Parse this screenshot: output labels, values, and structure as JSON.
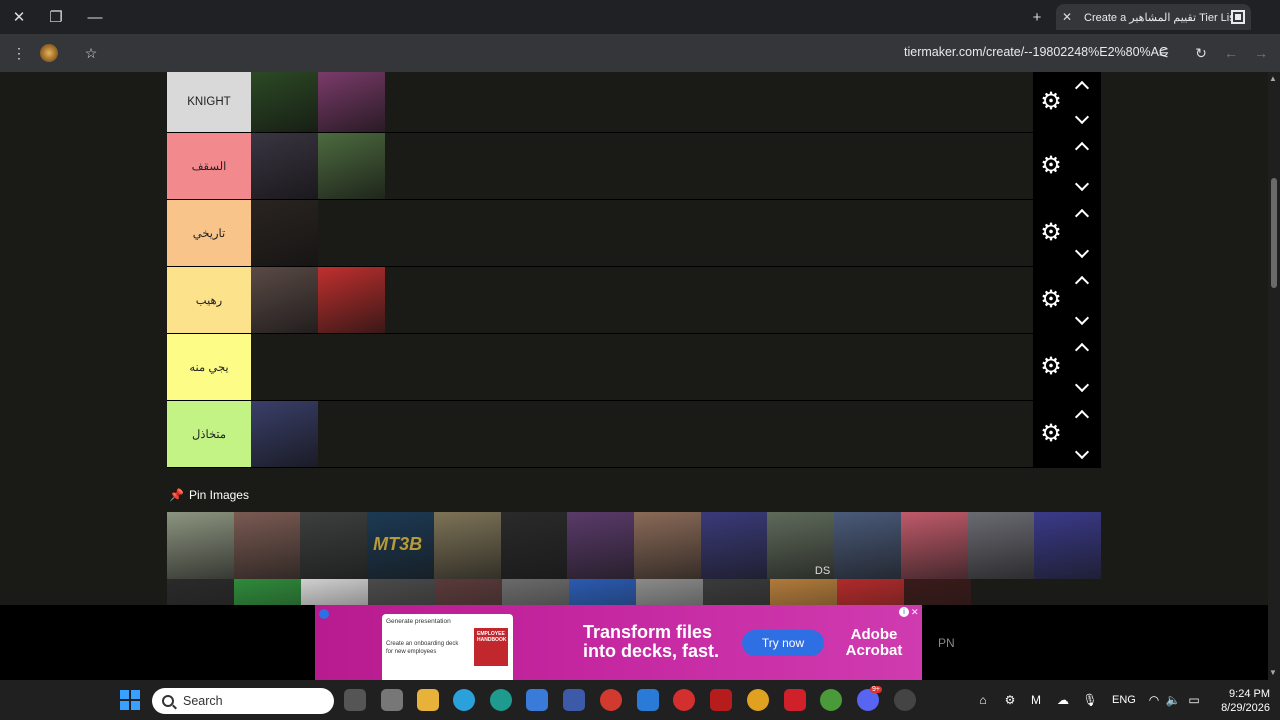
{
  "browser": {
    "tab_title": "Create a تقييم المشاهير Tier List",
    "url": "tiermaker.com/create/--19802248%E2%80%AC"
  },
  "tiers": [
    {
      "label": "KNIGHT",
      "color": "#d9d9d9",
      "item_colors": [
        "#2c4a24",
        "#7a3b6a"
      ]
    },
    {
      "label": "السقف",
      "color": "#f28a8d",
      "item_colors": [
        "#3a3542",
        "#4d6b3f"
      ]
    },
    {
      "label": "تاريخي",
      "color": "#f8c48a",
      "item_colors": [
        "#2a2420"
      ]
    },
    {
      "label": "رهيب",
      "color": "#fce28a",
      "item_colors": [
        "#5a4a46",
        "#c0302e"
      ]
    },
    {
      "label": "يجي منه",
      "color": "#fdfc86",
      "item_colors": []
    },
    {
      "label": "متخاذل",
      "color": "#c2f384",
      "item_colors": [
        "#3a3f6a"
      ]
    }
  ],
  "pin": {
    "label": "Pin Images",
    "row1": [
      "#8c9580",
      "#7a5a52",
      "#3c3f3d",
      "#1c3a54",
      "#7d7357",
      "#2a2a2a",
      "#5a3a6a",
      "#8a6a58",
      "#3a3a7a",
      "#5f6a5a",
      "#4a5a7a",
      "#c05a6a",
      "#6a6a72",
      "#3a3a8a"
    ],
    "row2": [
      "#2a2a2a",
      "#2e8a3a",
      "#cfcfcf",
      "#4a4a4a",
      "#5a3a3a",
      "#6a6a6a",
      "#2a5ab0",
      "#8a8a8a",
      "#3a3a3a",
      "#b07a3a",
      "#b02a2a",
      "#3a1a1a"
    ],
    "mt3b": "MT3B",
    "ds_text": "DS"
  },
  "ad": {
    "mock_title": "Generate presentation",
    "mock_body": "Create an onboarding deck for new employees",
    "mock_badge": "EMPLOYEE HANDBOOK",
    "headline": "Transform files into decks, fast.",
    "cta": "Try now",
    "brand": "Adobe Acrobat",
    "side_text": "PN"
  },
  "taskbar": {
    "search_placeholder": "Search",
    "lang": "ENG",
    "time": "9:24 PM",
    "date": "8/29/2026",
    "discord_badge": "9+"
  }
}
